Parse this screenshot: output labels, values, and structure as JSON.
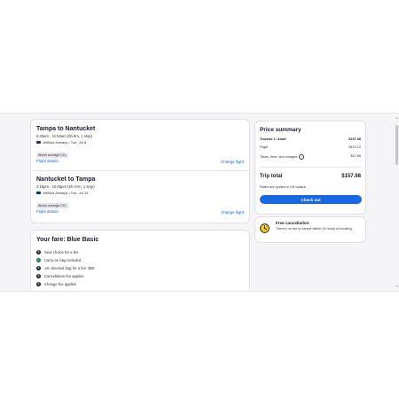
{
  "flights": [
    {
      "title": "Tampa to Nantucket",
      "times": "6:45am - 11:53am (5h 8m, 1 stop)",
      "airline": "JetBlue Airways • Tue, Jul 8",
      "co2": "Above average CO₂",
      "details_link": "Flight details",
      "change_link": "Change flight"
    },
    {
      "title": "Nantucket to Tampa",
      "times": "4:18pm - 10:05pm (5h 47m, 1 stop)",
      "airline": "JetBlue Airways • Tue, Jul 15",
      "co2": "Above average CO₂",
      "details_link": "Flight details",
      "change_link": "Change flight"
    }
  ],
  "fare": {
    "title": "Your fare: Blue Basic",
    "items": [
      {
        "icon": "dollar",
        "text": "Seat choice for a fee"
      },
      {
        "icon": "check",
        "text": "Carry-on bag included"
      },
      {
        "icon": "dollar",
        "text": "1st checked bag for a fee: $50"
      },
      {
        "icon": "dollar",
        "text": "Cancellation fee applies"
      },
      {
        "icon": "dollar",
        "text": "Change fee applies"
      }
    ]
  },
  "price_summary": {
    "title": "Price summary",
    "traveler_label": "Traveler 1: Adult",
    "traveler_amount": "$157.98",
    "flight_label": "Flight",
    "flight_amount": "$110.12",
    "taxes_label": "Taxes, fees, and charges",
    "taxes_amount": "$47.86",
    "trip_total_label": "Trip total",
    "trip_total_amount": "$157.98",
    "currency_note": "Rates are quoted in US dollars",
    "checkout_label": "Check out"
  },
  "cancellation": {
    "title": "Free cancellation",
    "text": "There's no fee to cancel within 24 hours of booking."
  },
  "icons": {
    "dollar": "$",
    "check": "✓",
    "info": "i",
    "scroll_up": "▲",
    "scroll_down": "▼"
  },
  "colors": {
    "accent": "#1668e3",
    "check_green": "#1b7f4b",
    "clock_yellow": "#f5c518"
  }
}
